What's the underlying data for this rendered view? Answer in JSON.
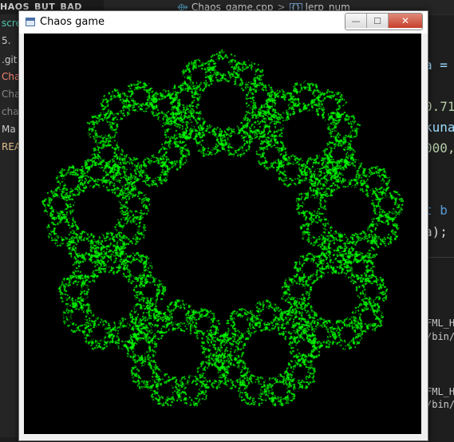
{
  "editor": {
    "sidebar_title": "HAOS_BUT_BAD",
    "breadcrumb_file": "Chaos_game.cpp",
    "breadcrumb_symbol": "lerp_num",
    "breadcrumb_separator": ">",
    "sidebar_items": [
      {
        "label": "scre",
        "color": "#4ec9b0"
      },
      {
        "label": "5.",
        "color": "#cccccc"
      },
      {
        "label": ".git",
        "color": "#cccccc"
      },
      {
        "label": "Cha",
        "color": "#f48771"
      },
      {
        "label": "Cha",
        "color": "#8b8b8b"
      },
      {
        "label": "cha",
        "color": "#8b8b8b"
      },
      {
        "label": "Ma",
        "color": "#cccccc"
      },
      {
        "label": "REA",
        "color": "#e2c08d"
      }
    ],
    "code_fragments": [
      {
        "text": "a =",
        "color": "#9cdcfe"
      },
      {
        "text": "0.71",
        "color": "#b5cea8"
      },
      {
        "text": "kuna",
        "color": "#9cdcfe"
      },
      {
        "text": "000,",
        "color": "#b5cea8"
      },
      {
        "text": "t b",
        "color": "#569cd6"
      },
      {
        "text": "a);",
        "color": "#d4d4d4"
      }
    ],
    "terminal_lines": [
      "FML_H",
      "/bin/",
      "FML_H",
      "/bin/"
    ]
  },
  "window": {
    "title": "Chaos game",
    "icon": "app-window-icon",
    "buttons": {
      "minimize": "—",
      "maximize": "☐",
      "close": "✕"
    }
  },
  "fractal": {
    "color": "#00ff00",
    "background": "#000000",
    "vertices": 9,
    "ratio": 0.7
  }
}
